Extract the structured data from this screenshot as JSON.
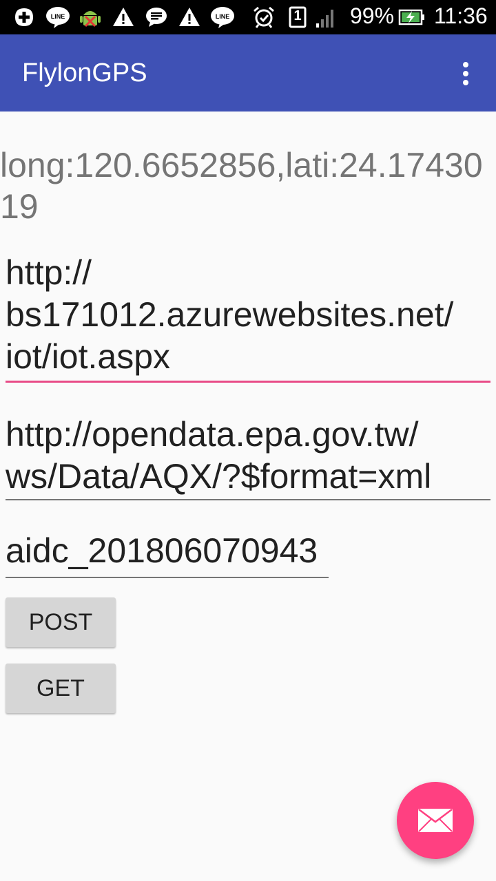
{
  "status_bar": {
    "battery": "99%",
    "time": "11:36",
    "sim_slot": "1",
    "icons": [
      "plus-box-icon",
      "line-icon",
      "android-debug-icon",
      "warning-icon",
      "message-icon",
      "warning-icon",
      "line-icon",
      "alarm-icon",
      "sim-icon",
      "signal-icon",
      "battery-charging-icon"
    ]
  },
  "app_bar": {
    "title": "FlylonGPS",
    "overflow_icon": "overflow-menu-icon"
  },
  "main": {
    "coordinates_text": "long:120.6652856,lati:24.1743019",
    "post_url": "http://\nbs171012.azurewebsites.net/\niot/iot.aspx",
    "get_url": "http://opendata.epa.gov.tw/\nws/Data/AQX/?$format=xml",
    "device_id": "aidc_201806070943",
    "post_button": "POST",
    "get_button": "GET"
  },
  "fab": {
    "icon": "mail-icon"
  },
  "colors": {
    "primary": "#3f51b5",
    "accent": "#ff4081",
    "focused_underline": "#e84b87"
  }
}
